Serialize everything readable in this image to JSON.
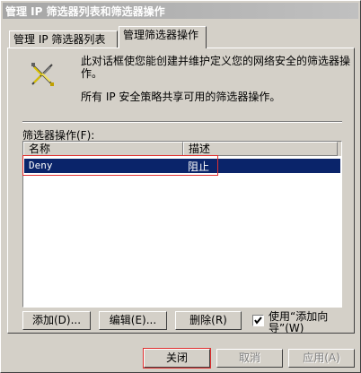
{
  "window": {
    "title": "管理 IP 筛选器列表和筛选器操作"
  },
  "tabs": [
    {
      "label": "管理 IP 筛选器列表"
    },
    {
      "label": "管理筛选器操作"
    }
  ],
  "panel": {
    "icon": "crossed-tools-icon",
    "description1": "此对话框使您能创建并维护定义您的网络安全的筛选器操作。",
    "description2": "所有 IP 安全策略共享可用的筛选器操作。",
    "list_label": "筛选器操作(F):",
    "columns": {
      "name": "名称",
      "description": "描述"
    },
    "rows": [
      {
        "name": "Deny",
        "description": "阻止",
        "selected": true
      }
    ],
    "buttons": {
      "add": "添加(D)...",
      "edit": "编辑(E)...",
      "remove": "删除(R)"
    },
    "wizard_checkbox": {
      "label": "使用“添加向导”(W)",
      "checked": true
    }
  },
  "footer": {
    "close": "关闭",
    "cancel": "取消",
    "apply": "应用(A)"
  },
  "colors": {
    "selection": "#0a246a",
    "highlight": "#e03030",
    "face": "#d4d0c8"
  }
}
